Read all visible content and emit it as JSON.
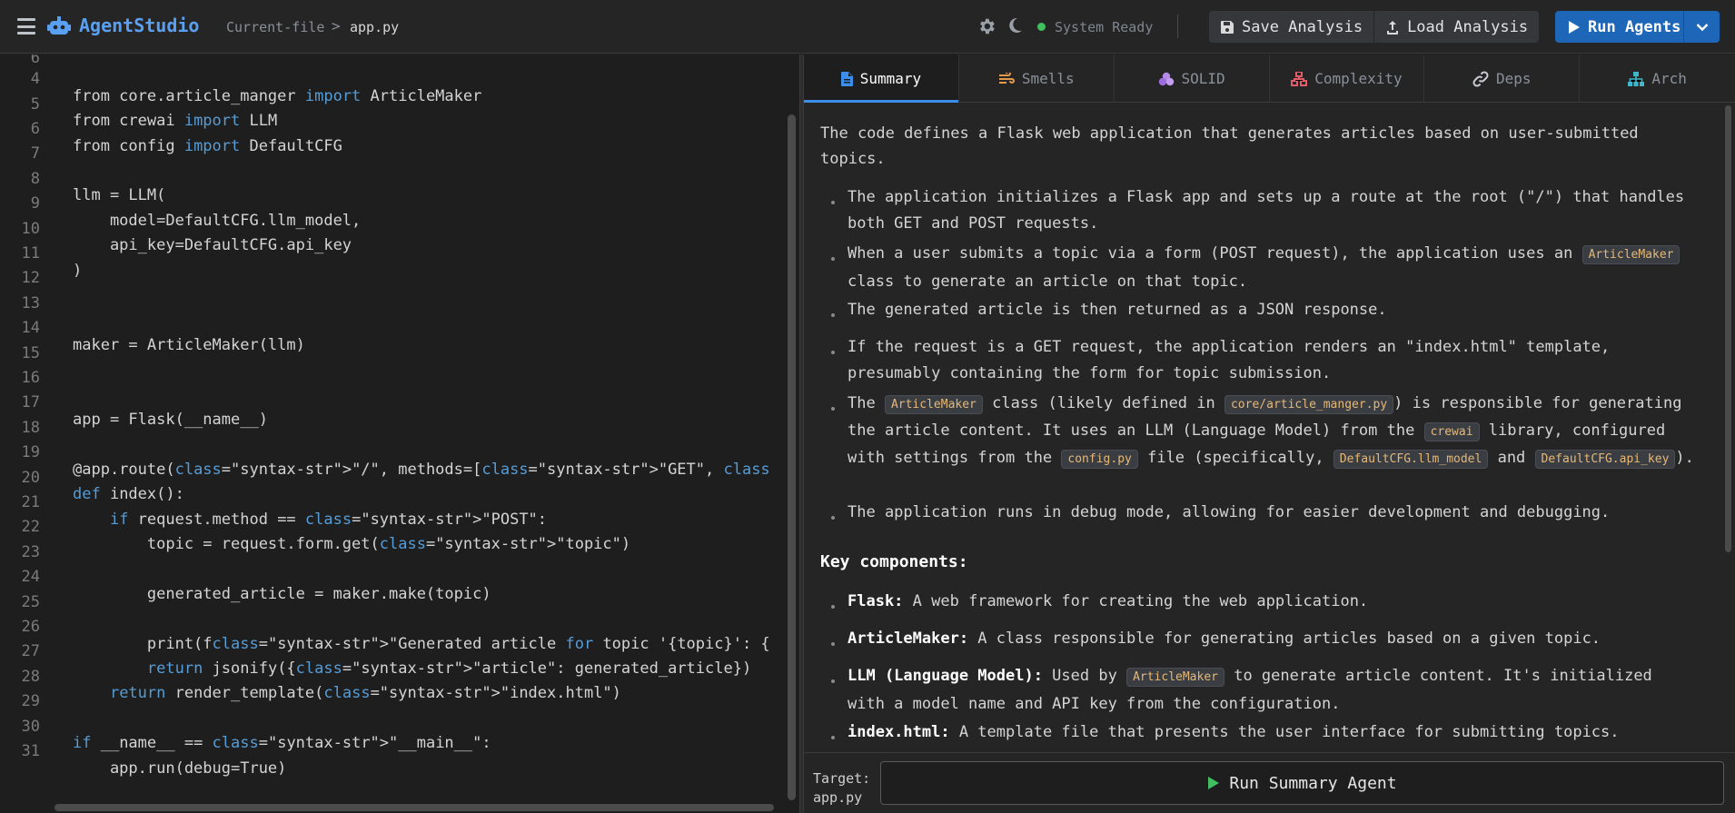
{
  "header": {
    "app_title": "AgentStudio",
    "breadcrumb_current": "Current-file",
    "breadcrumb_sep": ">",
    "breadcrumb_file": "app.py",
    "status_text": "System Ready",
    "save_label": "Save Analysis",
    "load_label": "Load Analysis",
    "run_label": "Run Agents",
    "accent_color": "#5aa0f2",
    "status_color": "#3fbf5f"
  },
  "editor": {
    "line_numbers": [
      "6",
      "4",
      "5",
      "6",
      "7",
      "8",
      "9",
      "10",
      "11",
      "12",
      "13",
      "14",
      "15",
      "16",
      "17",
      "18",
      "19",
      "20",
      "21",
      "22",
      "23",
      "24",
      "25",
      "26",
      "27",
      "28",
      "29",
      "30",
      "31"
    ],
    "lines": {
      "l4a": "from core.article_manger ",
      "l4k": "import",
      "l4b": " ArticleMaker",
      "l5a": "from crewai ",
      "l5k": "import",
      "l5b": " LLM",
      "l6a": "from config ",
      "l6k": "import",
      "l6b": " DefaultCFG",
      "l8": "llm = LLM(",
      "l9": "    model=DefaultCFG.llm_model,",
      "l10": "    api_key=DefaultCFG.api_key",
      "l11": ")",
      "l14": "maker = ArticleMaker(llm)",
      "l17": "app = Flask(__name__)",
      "l18a": "@app.route(",
      "l18k1": "class",
      "l18b": "=\"syntax-str\">\"/\", methods=[",
      "l18k2": "class",
      "l18c": "=\"syntax-str\">\"GET\", ",
      "l18k3": "class",
      "l19k": "def",
      "l19b": " index():",
      "l20a": "    ",
      "l20k1": "if",
      "l20b": " request.method == ",
      "l20k2": "class",
      "l20c": "=\"syntax-str\">\"POST\":",
      "l21a": "        topic = request.form.get(",
      "l21k": "class",
      "l21b": "=\"syntax-str\">\"topic\")",
      "l23": "        generated_article = maker.make(topic)",
      "l25a": "        print(f",
      "l25k1": "class",
      "l25b": "=\"syntax-str\">\"Generated article ",
      "l25k2": "for",
      "l25c": " topic '{topic}': {",
      "l26a": "        ",
      "l26k1": "return",
      "l26b": " jsonify({",
      "l26k2": "class",
      "l26c": "=\"syntax-str\">\"article\": generated_article})",
      "l27a": "    ",
      "l27k1": "return",
      "l27b": " render_template(",
      "l27k2": "class",
      "l27c": "=\"syntax-str\">\"index.html\")",
      "l28k1": "if",
      "l28b": " __name__ == ",
      "l28k2": "class",
      "l28c": "=\"syntax-str\">\"__main__\":",
      "l29": "    app.run(debug=True)"
    },
    "keyword_color": "#569cd6"
  },
  "tabs": [
    {
      "label": "Summary",
      "icon": "document-icon"
    },
    {
      "label": "Smells",
      "icon": "smells-icon"
    },
    {
      "label": "SOLID",
      "icon": "solid-icon"
    },
    {
      "label": "Complexity",
      "icon": "complexity-icon"
    },
    {
      "label": "Deps",
      "icon": "link-icon"
    },
    {
      "label": "Arch",
      "icon": "sitemap-icon"
    }
  ],
  "summary": {
    "intro": "The code defines a Flask web application that generates articles based on user-submitted topics.",
    "b1": "The application initializes a Flask app and sets up a route at the root (\"/\") that handles both GET and POST requests.",
    "b2a": "When a user submits a topic via a form (POST request), the application uses an ",
    "b2c": "ArticleMaker",
    "b2b": " class to generate an article on that topic.",
    "b3": "The generated article is then returned as a JSON response.",
    "b4": "If the request is a GET request, the application renders an \"index.html\" template, presumably containing the form for topic submission.",
    "b5a": "The ",
    "b5c1": "ArticleMaker",
    "b5b": " class (likely defined in ",
    "b5c2": "core/article_manger.py",
    "b5d": ") is responsible for generating the article content. It uses an LLM (Language Model) from the ",
    "b5c3": "crewai",
    "b5e": " library, configured with settings from the ",
    "b5c4": "config.py",
    "b5f": " file (specifically, ",
    "b5c5": "DefaultCFG.llm_model",
    "b5g": " and ",
    "b5c6": "DefaultCFG.api_key",
    "b5h": ").",
    "b6": "The application runs in debug mode, allowing for easier development and debugging.",
    "key_heading": "Key components:",
    "k1t": "Flask:",
    "k1": " A web framework for creating the web application.",
    "k2t": "ArticleMaker:",
    "k2": " A class responsible for generating articles based on a given topic.",
    "k3t": "LLM (Language Model):",
    "k3a": " Used by ",
    "k3c": "ArticleMaker",
    "k3b": " to generate article content. It's initialized with a model name and API key from the configuration.",
    "k4t": "index.html:",
    "k4": " A template file that presents the user interface for submitting topics."
  },
  "footer": {
    "target_label": "Target:",
    "target_file": "app.py",
    "run_summary_label": "Run Summary Agent"
  }
}
